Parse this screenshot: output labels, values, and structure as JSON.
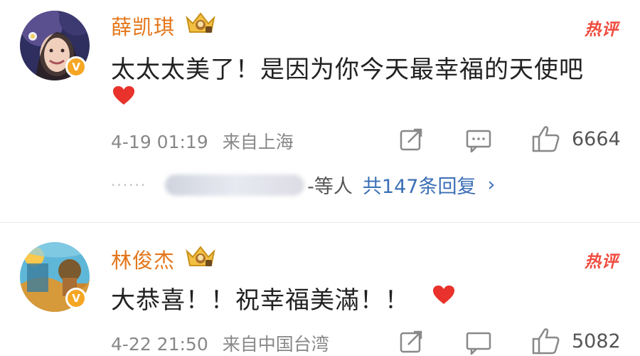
{
  "comments": [
    {
      "username": "薛凯琪",
      "verified_badge": "V",
      "hot_label": "热评",
      "text": "太太太美了！是因为你今天最幸福的天使吧",
      "time": "4-19 01:19",
      "source": "来自上海",
      "likes": "6664",
      "replies": {
        "suffix": "-等人",
        "link": "共147条回复",
        "chevron": "›"
      }
    },
    {
      "username": "林俊杰",
      "verified_badge": "V",
      "hot_label": "热评",
      "text": "大恭喜！！祝幸福美滿！！",
      "time": "4-22 21:50",
      "source": "来自中国台湾",
      "likes": "5082"
    }
  ],
  "icons": [
    "crown-badge-icon",
    "heart-icon",
    "share-icon",
    "comment-icon",
    "thumbs-up-icon",
    "chevron-right-icon"
  ],
  "colors": {
    "username": "#e4761a",
    "hot_label": "#f04b3f",
    "reply_link": "#3b6fb6",
    "meta": "#888888",
    "heart": "#e8322b",
    "verified": "#f5a623"
  }
}
